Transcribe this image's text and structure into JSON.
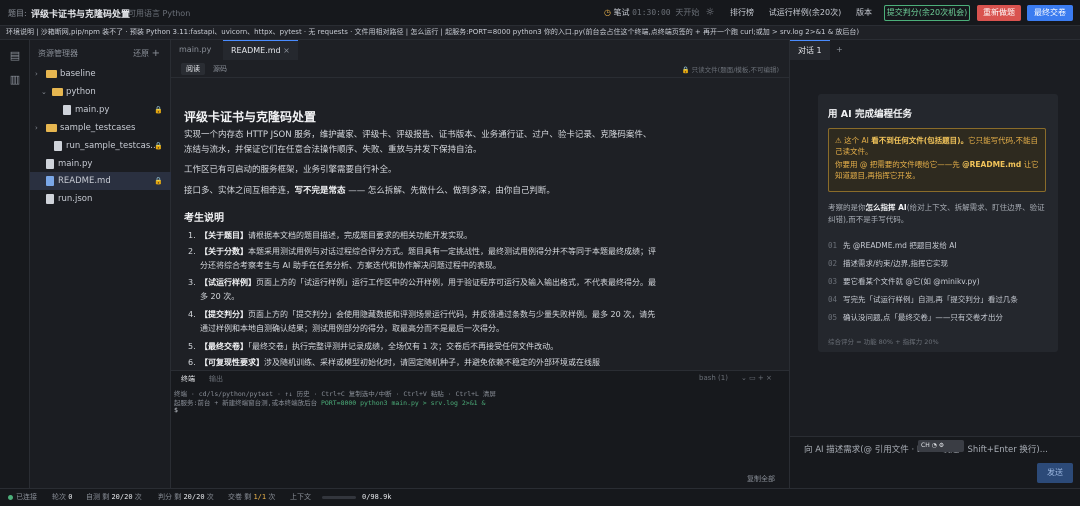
{
  "topbar": {
    "title_label": "题目:",
    "title": "评级卡证书与克隆码处置",
    "language": "可用语言 Python",
    "timer_label": "笔试",
    "timer_value": "01:30:00 天开始",
    "leaderboard": "排行榜",
    "test_run": "试运行样例(余20次)",
    "version": "版本",
    "submit": "提交判分(余20次机会)",
    "reset": "重新做题",
    "final": "最终交卷",
    "colors": {
      "submit_border": "#4caf7a",
      "reset_bg": "#d9534f",
      "final_bg": "#3b7cf0"
    }
  },
  "infobar": {
    "text": "环境说明 | 沙箱断网,pip/npm 装不了 · 预装 Python 3.11:fastapi、uvicorn、httpx、pytest · 无 requests · 文件用相对路径 | 怎么运行 | 起服务:PORT=8000 python3 你的入口.py(前台会占住这个终端,点终端页签的 + 再开一个跑 curl;或加 > srv.log 2>&1 & 放后台)"
  },
  "explorer": {
    "title": "资源管理器",
    "action": "还原",
    "items": [
      {
        "name": "baseline",
        "type": "folder",
        "depth": 0,
        "open": true
      },
      {
        "name": "python",
        "type": "folder",
        "depth": 1,
        "open": true
      },
      {
        "name": "main.py",
        "type": "file",
        "depth": 2,
        "locked": true
      },
      {
        "name": "sample_testcases",
        "type": "folder",
        "depth": 0,
        "open": true
      },
      {
        "name": "run_sample_testcas...",
        "type": "file",
        "depth": 1,
        "locked": true
      },
      {
        "name": "main.py",
        "type": "file",
        "depth": 0,
        "locked": false
      },
      {
        "name": "README.md",
        "type": "file",
        "depth": 0,
        "locked": true,
        "selected": true
      },
      {
        "name": "run.json",
        "type": "file",
        "depth": 0,
        "locked": false
      }
    ]
  },
  "editor": {
    "tabs": [
      {
        "label": "main.py"
      },
      {
        "label": "README.md",
        "active": true
      }
    ],
    "modes": [
      "阅读",
      "源码"
    ],
    "readonly_note": "只读文件(题面/模板,不可编辑)",
    "doc": {
      "title": "评级卡证书与克隆码处置",
      "p1": "实现一个内存态 HTTP JSON 服务，维护藏家、评级卡、评级报告、证书版本、业务通行证、过户、验卡记录、克隆码案件、冻结与流水，并保证它们在任意合法操作顺序、失败、重放与并发下保持自洽。",
      "p2": "工作区已有可启动的服务框架，业务引擎需要自行补全。",
      "p3_a": "接口多、实体之间互相牵连，",
      "p3_b": "写不完是常态",
      "p3_c": " —— 怎么拆解、先做什么、做到多深，由你自己判断。",
      "h2": "考生说明",
      "list": [
        {
          "n": "1.",
          "b": "【关于题目】",
          "t": "请根据本文档的题目描述，完成题目要求的相关功能开发实现。"
        },
        {
          "n": "2.",
          "b": "【关于分数】",
          "t": "本题采用测试用例与对话过程综合评分方式。题目具有一定挑战性，最终测试用例得分并不等同于本题最终成绩；评分还将综合考察考生与 AI 助手在任务分析、方案迭代和协作解决问题过程中的表现。"
        },
        {
          "n": "3.",
          "b": "【试运行样例】",
          "t": "页面上方的「试运行样例」运行工作区中的公开样例，用于验证程序可运行及输入输出格式，不代表最终得分。最多 20 次。"
        },
        {
          "n": "4.",
          "b": "【提交判分】",
          "t": "页面上方的「提交判分」会使用隐藏数据和评测场景运行代码，并反馈通过条数与少量失败样例。最多 20 次，请先通过样例和本地自测确认结果；测试用例部分的得分，取最高分而不是最后一次得分。"
        },
        {
          "n": "5.",
          "b": "【最终交卷】",
          "t": "「最终交卷」执行完整评测并记录成绩，全场仅有 1 次；交卷后不再接受任何文件改动。"
        },
        {
          "n": "6.",
          "b": "【可复现性要求】",
          "t": "涉及随机训练、采样或模型初始化时，请固定随机种子，并避免依赖不稳定的外部环境或在线服"
        }
      ]
    }
  },
  "terminal": {
    "tabs": [
      "终端",
      "输出"
    ],
    "shell": "bash (1)",
    "line1": "终端 · cd/ls/python/pytest · ↑↓ 历史 · Ctrl+C 复制选中/中断 · Ctrl+V 粘贴 · Ctrl+L 清屏",
    "line2_a": "起服务:前台 + 新建终端窗台测,或本终端放后台",
    "line2_b": "PORT=8000 python3 main.py > srv.log 2>&1 &",
    "prompt": "$",
    "copy_all": "复制全部"
  },
  "ai": {
    "tabs": [
      "对话 1",
      "+"
    ],
    "card_title": "用 AI 完成编程任务",
    "warn_1a": "⚠ 这个 AI ",
    "warn_1b": "看不到任何文件(包括题目)。",
    "warn_1c": "它只能写代码,不能自己读文件。",
    "warn_2a": "你要用 @ 把需要的文件喂给它——先 ",
    "warn_2b": "@README.md",
    "warn_2c": " 让它知道题目,再指挥它开发。",
    "intro_a": "考察的是你",
    "intro_b": "怎么指挥 AI",
    "intro_c": "(给对上下文、拆解需求、盯住边界、验证纠错),而不是手写代码。",
    "steps": [
      {
        "n": "01",
        "t": "先 @README.md 把题目发给 AI"
      },
      {
        "n": "02",
        "t": "描述需求/约束/边界,指挥它实现"
      },
      {
        "n": "03",
        "t": "要它看某个文件就 @它(如 @minikv.py)"
      },
      {
        "n": "04",
        "t": "写完先「试运行样例」自测,再「提交判分」看过几条"
      },
      {
        "n": "05",
        "t": "确认没问题,点「最终交卷」——只有交卷才出分"
      }
    ],
    "score": "综合评分 = 功能 80% + 指挥力 20%",
    "input_placeholder": "向 AI 描述需求(@ 引用文件 · Enter 发送 · Shift+Enter 换行)...",
    "send": "发送"
  },
  "status": {
    "connected": "已连接",
    "rounds_label": "轮次",
    "rounds": "0",
    "test_label": "自测 剩",
    "test": "20/20",
    "test_unit": "次",
    "judge_label": "判分 剩",
    "judge": "20/20",
    "judge_unit": "次",
    "final_label": "交卷 剩",
    "final": "1/1",
    "final_unit": "次",
    "context_label": "上下文",
    "context": "0/98.9k",
    "context_fraction": 0
  }
}
